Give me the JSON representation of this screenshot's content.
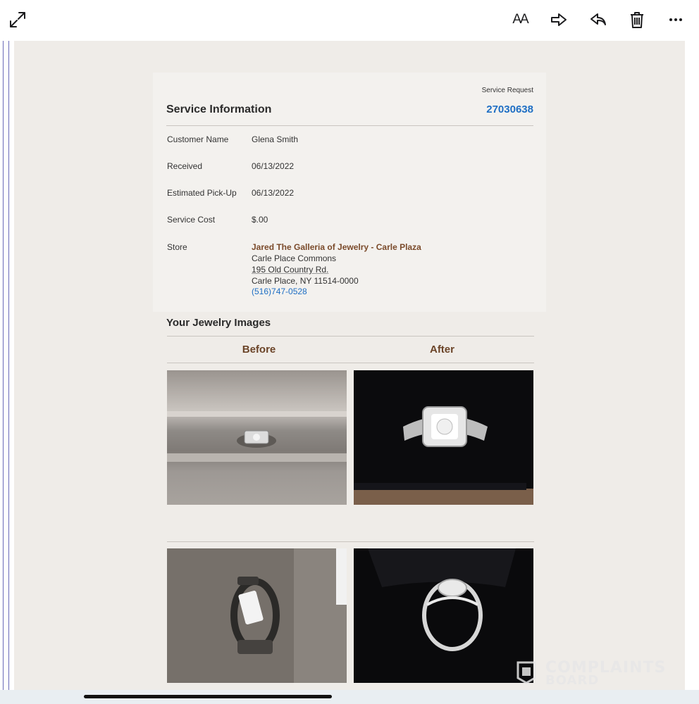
{
  "toolbar": {
    "expand_icon": "expand-arrows-icon",
    "text_size_label": "AA",
    "forward_icon": "forward-arrow-icon",
    "reply_icon": "reply-arrow-icon",
    "trash_icon": "trash-icon",
    "more_icon": "ellipsis-icon"
  },
  "service": {
    "request_label": "Service Request",
    "title": "Service Information",
    "request_number": "27030638",
    "rows": [
      {
        "label": "Customer Name",
        "value": "Glena Smith"
      },
      {
        "label": "Received",
        "value": "06/13/2022"
      },
      {
        "label": "Estimated Pick-Up",
        "value": "06/13/2022"
      },
      {
        "label": "Service Cost",
        "value": "$.00"
      }
    ],
    "store": {
      "label": "Store",
      "name": "Jared The Galleria of Jewelry - Carle Plaza",
      "mall": "Carle Place Commons",
      "street": "195 Old Country Rd.",
      "city": "Carle Place, NY 11514-0000",
      "phone": "(516)747-0528"
    }
  },
  "images": {
    "title": "Your Jewelry Images",
    "before_label": "Before",
    "after_label": "After"
  },
  "watermark": {
    "line1": "COMPLAINTS",
    "line2": "BOARD"
  },
  "colors": {
    "link": "#1f6fc4",
    "accent_brown": "#6b4428",
    "background": "#efece8"
  }
}
